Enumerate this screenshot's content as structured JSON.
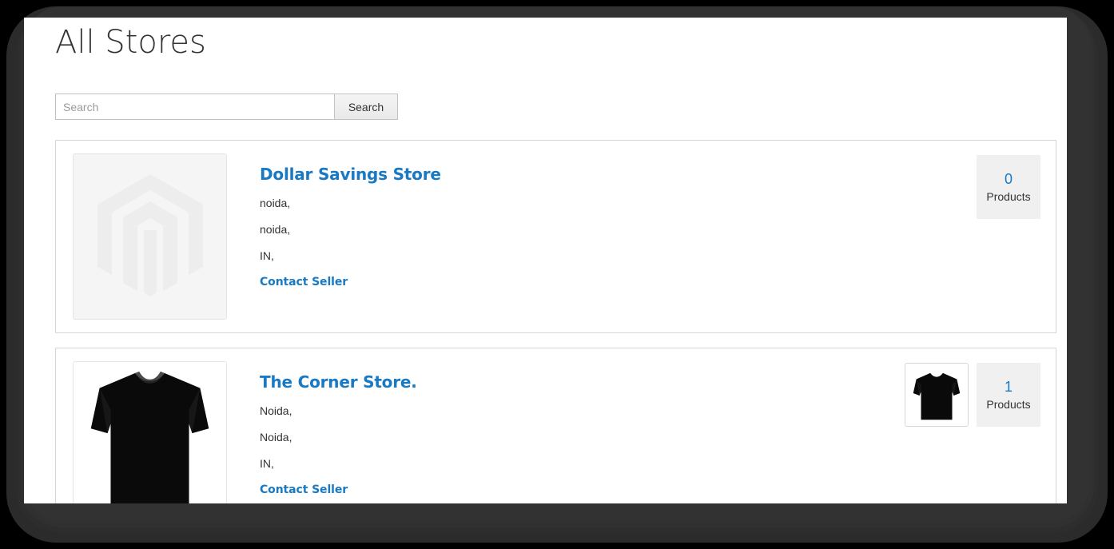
{
  "page": {
    "title": "All Stores"
  },
  "search": {
    "placeholder": "Search",
    "value": "",
    "button_label": "Search",
    "icon": "search-icon"
  },
  "colors": {
    "link_blue": "#1979c3",
    "text_dark": "#333333",
    "card_border": "#d6d6d6",
    "badge_bg": "#f0f0f0",
    "placeholder_bg": "#f5f5f5",
    "bezel": "#2b2b2b"
  },
  "stores": [
    {
      "name": "Dollar Savings Store",
      "address_lines": [
        "noida,",
        "noida,",
        "IN,"
      ],
      "contact_label": "Contact Seller",
      "logo_type": "magento-placeholder-image",
      "product_count": "0",
      "product_count_label": "Products",
      "product_thumbs": []
    },
    {
      "name": "The Corner Store.",
      "address_lines": [
        "Noida,",
        "Noida,",
        "IN,"
      ],
      "contact_label": "Contact Seller",
      "logo_type": "black-tshirt-image",
      "product_count": "1",
      "product_count_label": "Products",
      "product_thumbs": [
        "black-tshirt-thumbnail"
      ]
    }
  ]
}
